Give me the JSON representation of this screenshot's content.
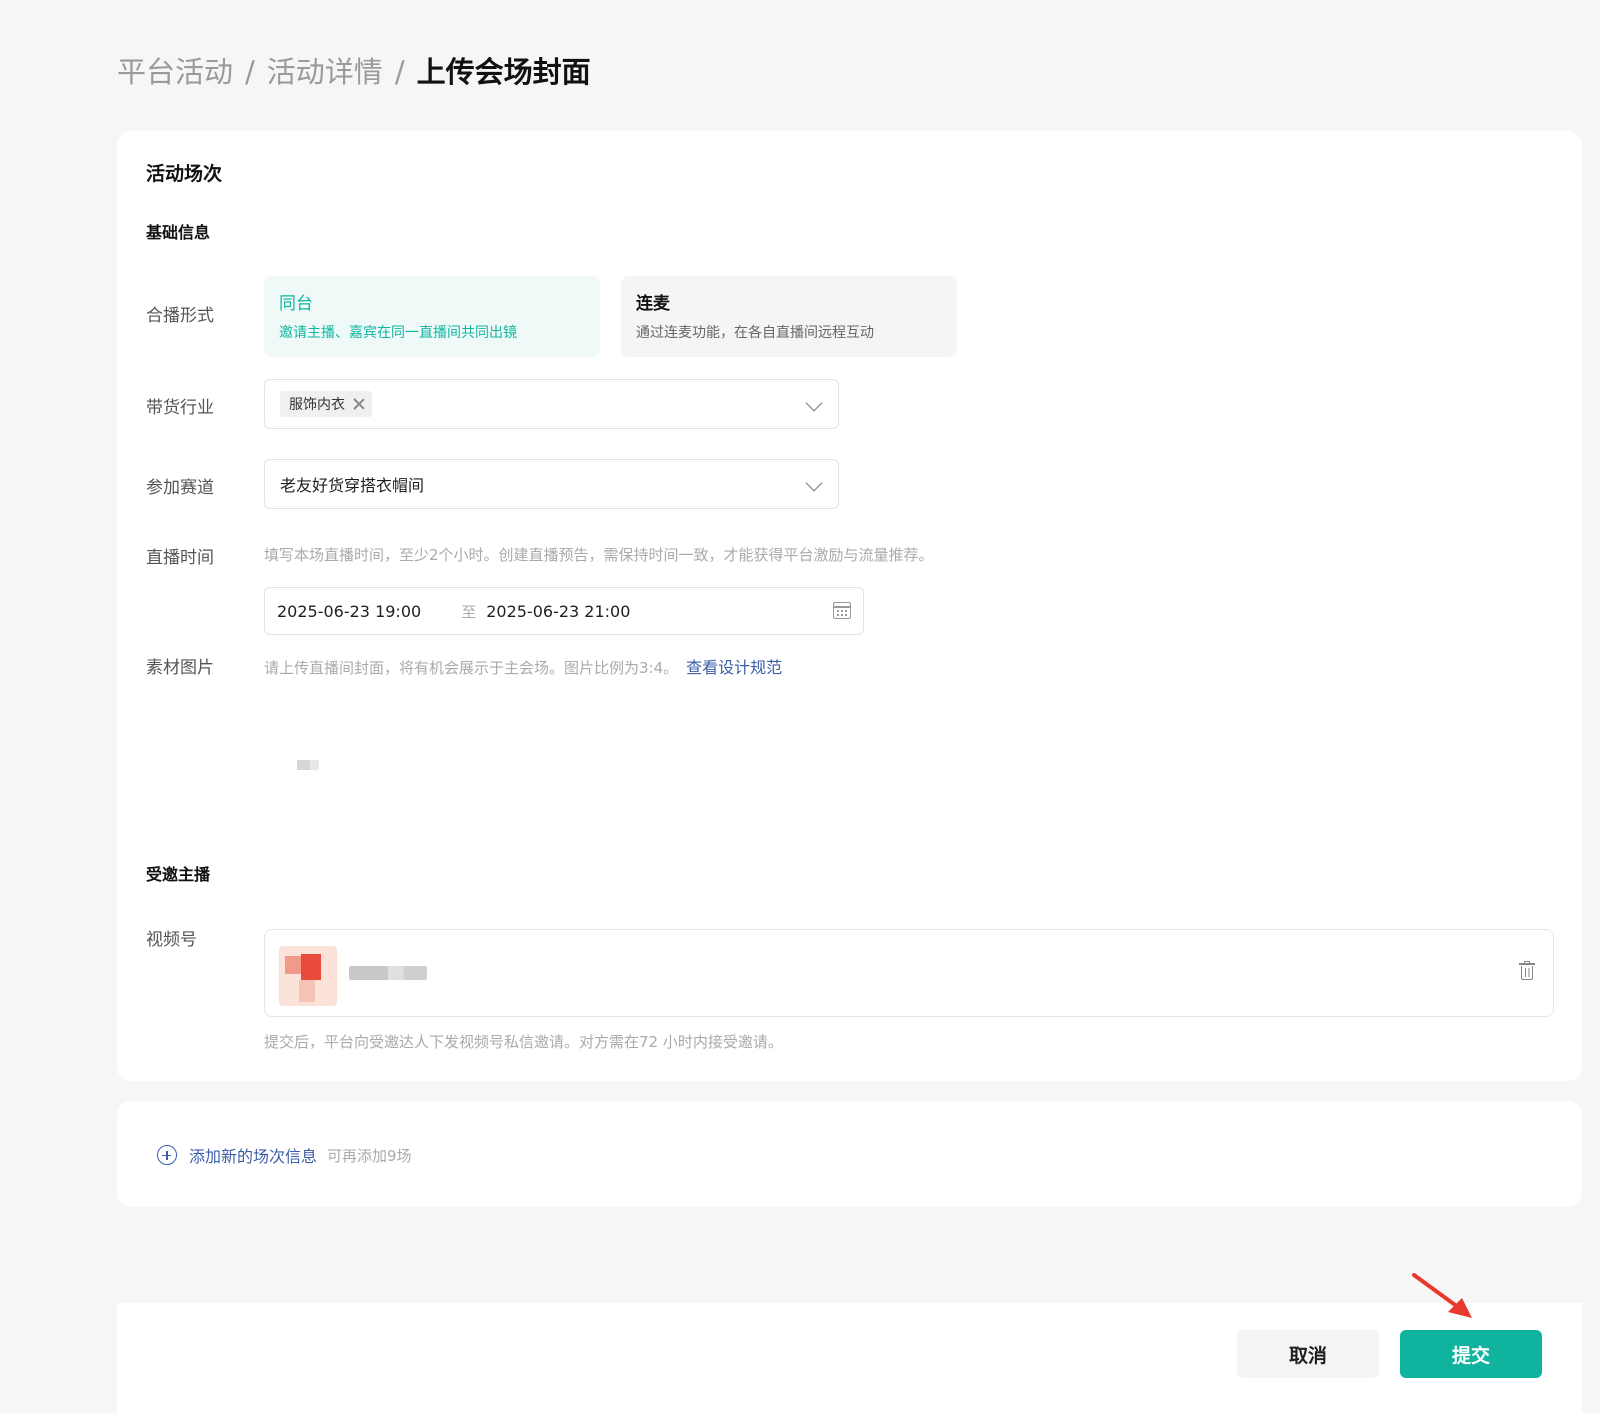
{
  "breadcrumb": {
    "items": [
      "平台活动",
      "活动详情"
    ],
    "current": "上传会场封面",
    "separator": "/"
  },
  "section": {
    "title": "活动场次",
    "basic_info": "基础信息"
  },
  "broadcast_mode": {
    "label": "合播形式",
    "options": [
      {
        "title": "同台",
        "desc": "邀请主播、嘉宾在同一直播间共同出镜",
        "selected": true
      },
      {
        "title": "连麦",
        "desc": "通过连麦功能，在各自直播间远程互动",
        "selected": false
      }
    ]
  },
  "industry": {
    "label": "带货行业",
    "tag": "服饰内衣"
  },
  "track": {
    "label": "参加赛道",
    "value": "老友好货穿搭衣帽间"
  },
  "live_time": {
    "label": "直播时间",
    "hint": "填写本场直播时间，至少2个小时。创建直播预告，需保持时间一致，才能获得平台激励与流量推荐。",
    "start": "2025-06-23 19:00",
    "separator": "至",
    "end": "2025-06-23 21:00"
  },
  "material": {
    "label": "素材图片",
    "hint": "请上传直播间封面，将有机会展示于主会场。图片比例为3:4。",
    "link": "查看设计规范"
  },
  "invited": {
    "title": "受邀主播",
    "label": "视频号",
    "note": "提交后，平台向受邀达人下发视频号私信邀请。对方需在72 小时内接受邀请。"
  },
  "add_session": {
    "label": "添加新的场次信息",
    "note": "可再添加9场"
  },
  "footer": {
    "cancel": "取消",
    "submit": "提交"
  },
  "colors": {
    "accent": "#0fb39e",
    "link": "#3b5ea8",
    "annotation_arrow": "#e8392f"
  }
}
